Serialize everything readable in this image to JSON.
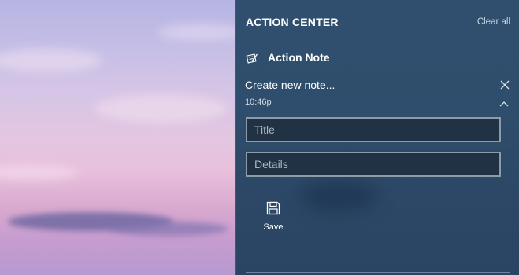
{
  "panel": {
    "title": "ACTION CENTER",
    "clear_all_label": "Clear all"
  },
  "notification": {
    "app_name": "Action Note",
    "app_icon": "note-pen-icon",
    "title": "Create new note...",
    "time": "10:46p",
    "close_icon": "close-icon",
    "collapse_icon": "chevron-up-icon",
    "title_field": {
      "placeholder": "Title",
      "value": ""
    },
    "details_field": {
      "placeholder": "Details",
      "value": ""
    },
    "save_button": {
      "label": "Save",
      "icon": "save-icon"
    }
  },
  "colors": {
    "panel_background": "#2f4d6c",
    "field_background": "#213245",
    "field_border": "#8d9aa8"
  }
}
